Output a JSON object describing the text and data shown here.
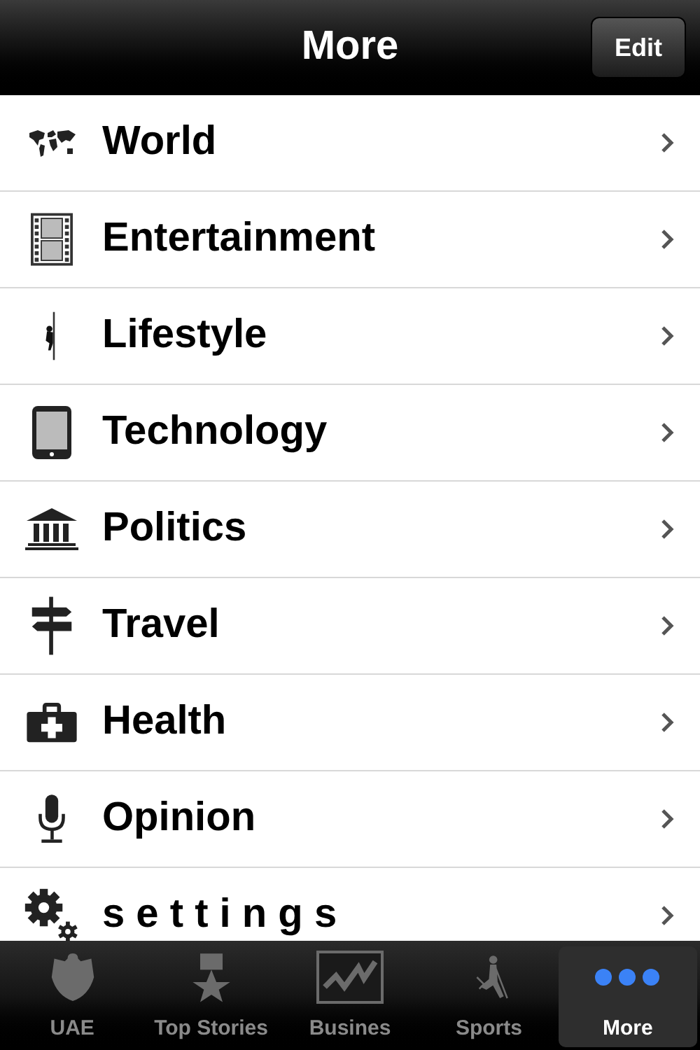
{
  "nav_bar": {
    "title": "More",
    "edit_button": "Edit"
  },
  "items": [
    {
      "label": "World"
    },
    {
      "label": "Entertainment"
    },
    {
      "label": "Lifestyle"
    },
    {
      "label": "Technology"
    },
    {
      "label": "Politics"
    },
    {
      "label": "Travel"
    },
    {
      "label": "Health"
    },
    {
      "label": "Opinion"
    },
    {
      "label": "s e t t i n g s"
    }
  ],
  "tab_bar": [
    {
      "label": "UAE",
      "selected": false
    },
    {
      "label": "Top Stories",
      "selected": false
    },
    {
      "label": "Busines",
      "selected": false
    },
    {
      "label": "Sports",
      "selected": false
    },
    {
      "label": "More",
      "selected": true
    }
  ]
}
